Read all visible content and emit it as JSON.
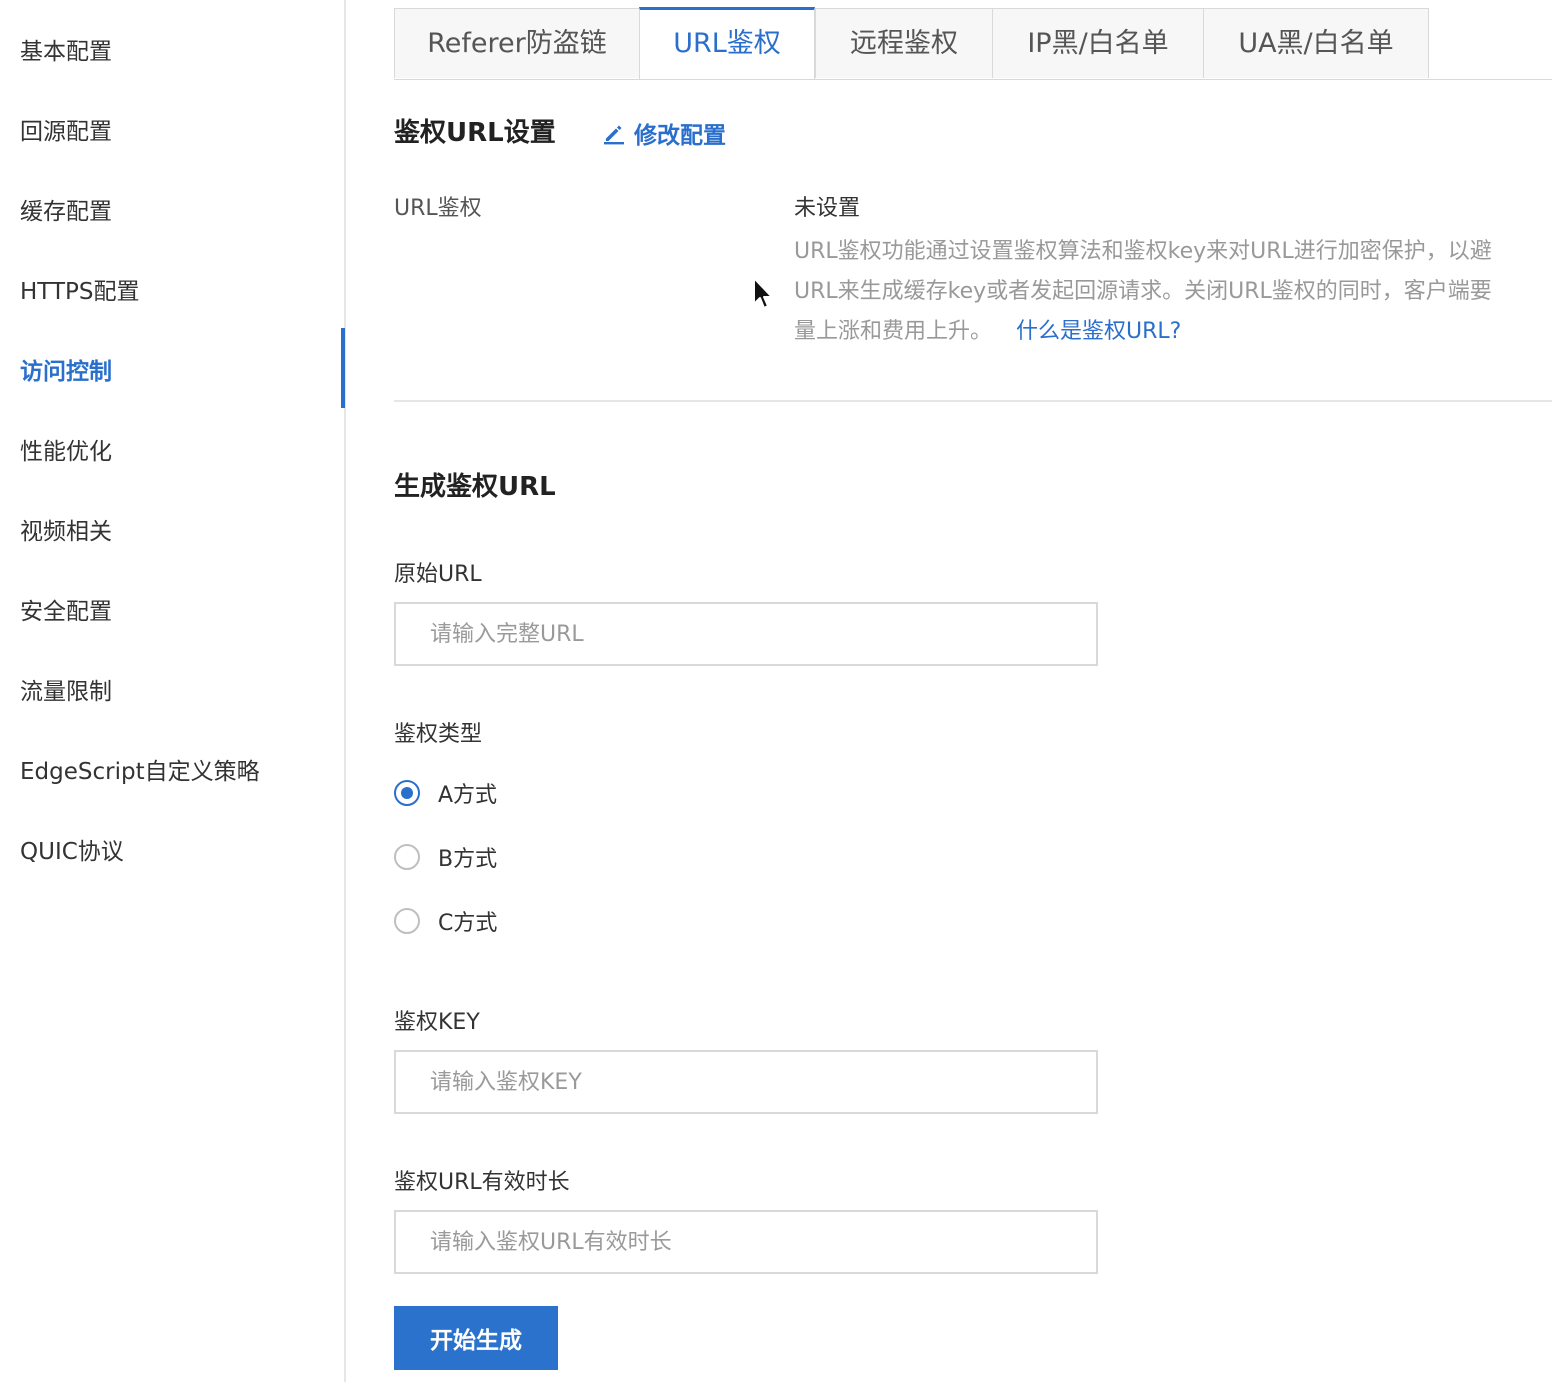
{
  "sidebar": {
    "items": [
      {
        "label": "基本配置"
      },
      {
        "label": "回源配置"
      },
      {
        "label": "缓存配置"
      },
      {
        "label": "HTTPS配置"
      },
      {
        "label": "访问控制",
        "active": true
      },
      {
        "label": "性能优化"
      },
      {
        "label": "视频相关"
      },
      {
        "label": "安全配置"
      },
      {
        "label": "流量限制"
      },
      {
        "label": "EdgeScript自定义策略"
      },
      {
        "label": "QUIC协议"
      }
    ]
  },
  "tabs": [
    {
      "label": "Referer防盗链"
    },
    {
      "label": "URL鉴权",
      "active": true
    },
    {
      "label": "远程鉴权"
    },
    {
      "label": "IP黑/白名单"
    },
    {
      "label": "UA黑/白名单"
    }
  ],
  "settings": {
    "title": "鉴权URL设置",
    "edit_label": "修改配置",
    "edit_icon": "pencil-icon",
    "field_label": "URL鉴权",
    "field_value": "未设置",
    "desc_line1": "URL鉴权功能通过设置鉴权算法和鉴权key来对URL进行加密保护，以避",
    "desc_line2": "URL来生成缓存key或者发起回源请求。关闭URL鉴权的同时，客户端要",
    "desc_line3": "量上涨和费用上升。",
    "help_link": "什么是鉴权URL?"
  },
  "generate": {
    "title": "生成鉴权URL",
    "origin_url_label": "原始URL",
    "origin_url_placeholder": "请输入完整URL",
    "origin_url_value": "",
    "auth_type_label": "鉴权类型",
    "auth_types": [
      {
        "label": "A方式",
        "checked": true
      },
      {
        "label": "B方式",
        "checked": false
      },
      {
        "label": "C方式",
        "checked": false
      }
    ],
    "key_label": "鉴权KEY",
    "key_placeholder": "请输入鉴权KEY",
    "key_value": "",
    "ttl_label": "鉴权URL有效时长",
    "ttl_placeholder": "请输入鉴权URL有效时长",
    "ttl_value": "",
    "submit_label": "开始生成"
  },
  "colors": {
    "accent": "#2b6fcc",
    "button": "#2a72cc",
    "muted_text": "#999999",
    "border": "#d9d9d9"
  }
}
